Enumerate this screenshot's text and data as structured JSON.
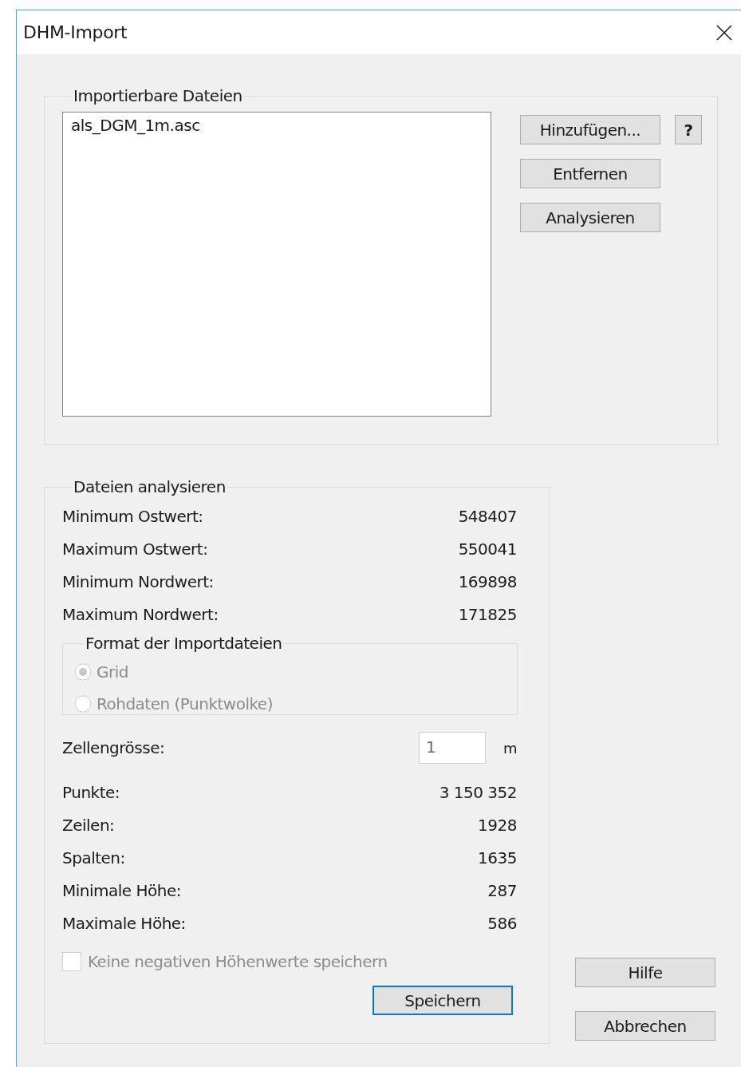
{
  "window": {
    "title": "DHM-Import"
  },
  "import_group": {
    "title": "Importierbare Dateien",
    "files": [
      {
        "name": "als_DGM_1m.asc",
        "selected": false
      }
    ],
    "buttons": [
      {
        "label": "Hinzufügen..."
      },
      {
        "label": "Entfernen"
      },
      {
        "label": "Analysieren"
      }
    ],
    "help_button": "?"
  },
  "analysis_group": {
    "title": "Dateien analysieren",
    "extents": [
      {
        "label": "Minimum Ostwert:",
        "value": "548407"
      },
      {
        "label": "Maximum Ostwert:",
        "value": "550041"
      },
      {
        "label": "Minimum Nordwert:",
        "value": "169898"
      },
      {
        "label": "Maximum Nordwert:",
        "value": "171825"
      }
    ],
    "format": {
      "title": "Format der Importdateien",
      "disabled": true,
      "options": [
        {
          "label": "Grid",
          "selected": true
        },
        {
          "label": "Rohdaten (Punktwolke)",
          "selected": false
        }
      ]
    },
    "cell_size": {
      "label": "Zellengrösse:",
      "value": "1",
      "unit": "m"
    },
    "stats": [
      {
        "label": "Punkte:",
        "value": "3 150 352"
      },
      {
        "label": "Zeilen:",
        "value": "1928"
      },
      {
        "label": "Spalten:",
        "value": "1635"
      },
      {
        "label": "Minimale Höhe:",
        "value": "287"
      },
      {
        "label": "Maximale Höhe:",
        "value": "586"
      }
    ],
    "no_negative": {
      "label": "Keine negativen Höhenwerte speichern",
      "checked": false,
      "disabled": true
    },
    "save_button": {
      "label": "Speichern",
      "focused": true
    }
  },
  "buttons": [
    {
      "label": "Hilfe"
    },
    {
      "label": "Abbrechen"
    }
  ]
}
